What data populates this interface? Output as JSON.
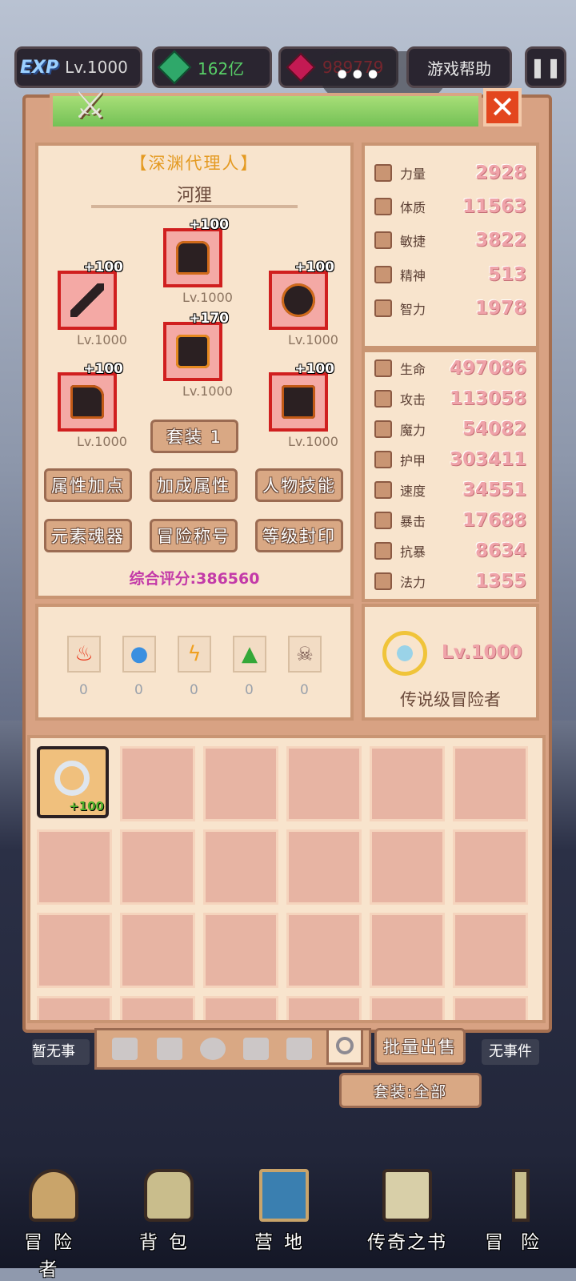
{
  "hud": {
    "exp_badge": "EXP",
    "level": "Lv.1000",
    "gems": "162亿",
    "rubies": "989779",
    "help": "游戏帮助",
    "pause_icon": "pause-icon"
  },
  "character": {
    "title": "【深渊代理人】",
    "name": "河狸",
    "equipment": [
      {
        "slot": "head",
        "plus": "+100",
        "level": "Lv.1000"
      },
      {
        "slot": "weapon",
        "plus": "+100",
        "level": "Lv.1000"
      },
      {
        "slot": "shield",
        "plus": "+100",
        "level": "Lv.1000"
      },
      {
        "slot": "armor",
        "plus": "+170",
        "level": "Lv.1000"
      },
      {
        "slot": "gloves",
        "plus": "+100",
        "level": "Lv.1000"
      },
      {
        "slot": "boots",
        "plus": "+100",
        "level": "Lv.1000"
      }
    ],
    "set_label": "套装 1",
    "buttons": [
      "属性加点",
      "加成属性",
      "人物技能",
      "元素魂器",
      "冒险称号",
      "等级封印"
    ],
    "score": "综合评分:386560"
  },
  "base_stats": [
    {
      "name": "力量",
      "value": "2928"
    },
    {
      "name": "体质",
      "value": "11563"
    },
    {
      "name": "敏捷",
      "value": "3822"
    },
    {
      "name": "精神",
      "value": "513"
    },
    {
      "name": "智力",
      "value": "1978"
    }
  ],
  "combat_stats": [
    {
      "name": "生命",
      "value": "497086"
    },
    {
      "name": "攻击",
      "value": "113058"
    },
    {
      "name": "魔力",
      "value": "54082"
    },
    {
      "name": "护甲",
      "value": "303411"
    },
    {
      "name": "速度",
      "value": "34551"
    },
    {
      "name": "暴击",
      "value": "17688"
    },
    {
      "name": "抗暴",
      "value": "8634"
    },
    {
      "name": "法力",
      "value": "1355"
    }
  ],
  "elements": [
    {
      "icon": "fire-icon",
      "count": "0"
    },
    {
      "icon": "water-icon",
      "count": "0"
    },
    {
      "icon": "lightning-icon",
      "count": "0"
    },
    {
      "icon": "earth-icon",
      "count": "0"
    },
    {
      "icon": "skull-icon",
      "count": "0"
    }
  ],
  "rank": {
    "level": "Lv.1000",
    "title": "传说级冒险者"
  },
  "inventory": {
    "first_item_plus": "+100",
    "bulk_sell": "批量出售",
    "set_filter": "套装:全部",
    "left_event": "暂无事",
    "right_event": "无事件"
  },
  "nav": [
    "冒险者",
    "背包",
    "营地",
    "传奇之书",
    "冒险"
  ],
  "colors": {
    "accent_red": "#d01f1f",
    "stat_pink": "#efa3a9",
    "panel": "#f8e4cd"
  }
}
